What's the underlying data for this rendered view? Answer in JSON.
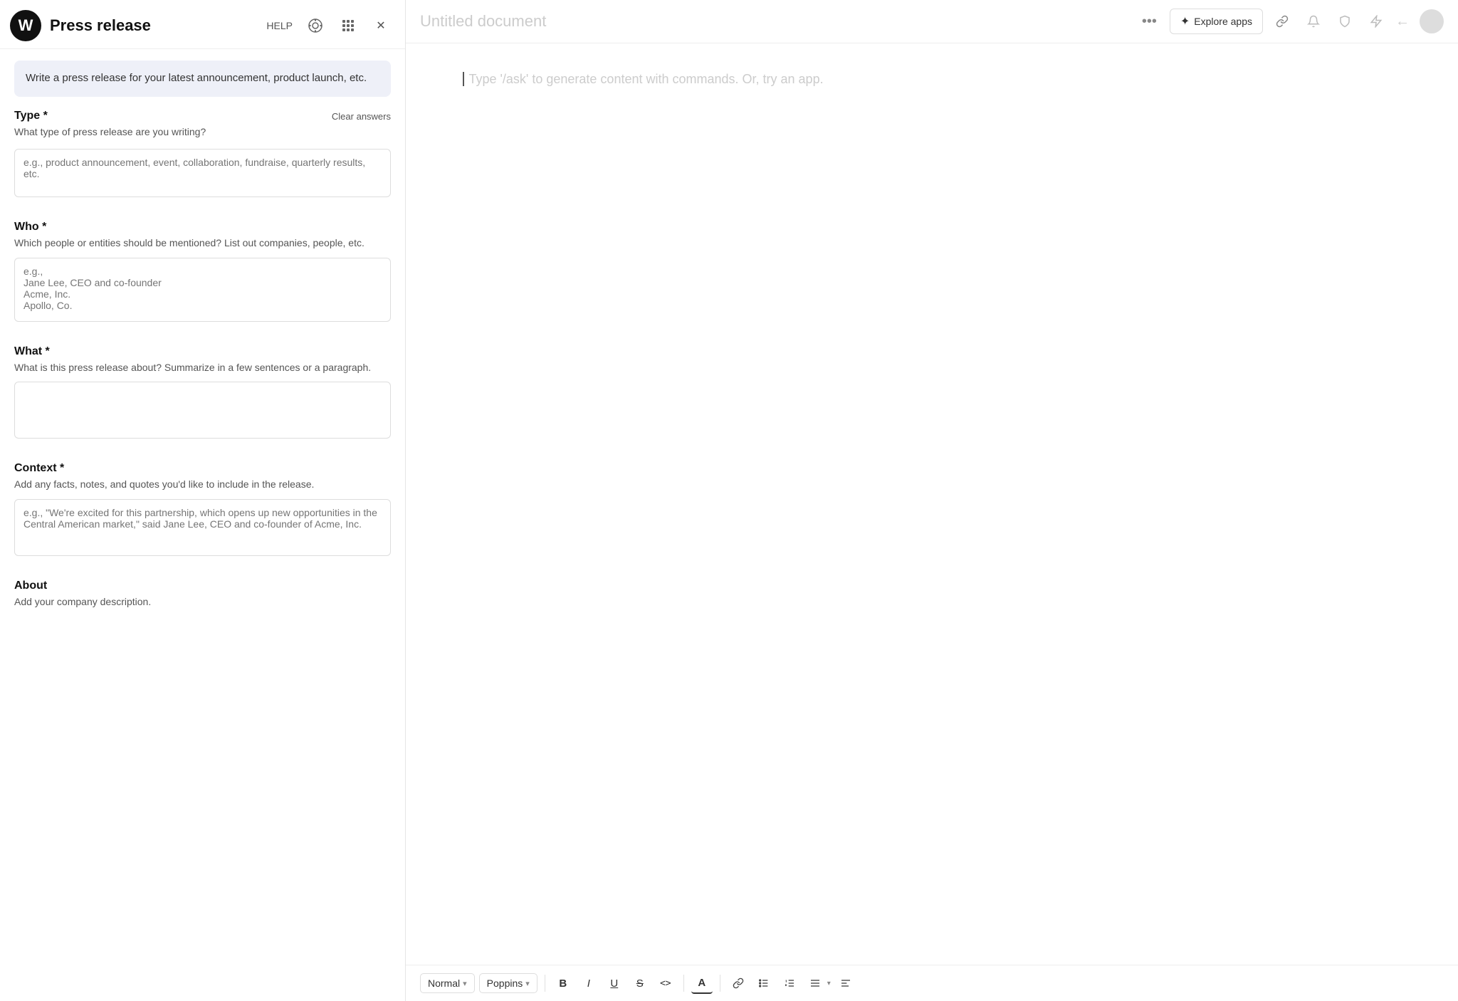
{
  "app": {
    "logo": "W",
    "panel_title": "Press release"
  },
  "header": {
    "help_label": "HELP",
    "close_icon": "✕",
    "grid_icon": "⋮⋮",
    "help_circle_icon": "⊙"
  },
  "description": {
    "text": "Write a press release for your latest announcement, product launch, etc."
  },
  "fields": [
    {
      "id": "type",
      "label": "Type *",
      "description": "What type of press release are you writing?",
      "placeholder": "e.g., product announcement, event, collaboration, fundraise, quarterly results, etc.",
      "rows": "small",
      "show_clear": true
    },
    {
      "id": "who",
      "label": "Who *",
      "description": "Which people or entities should be mentioned? List out companies, people, etc.",
      "placeholder": "e.g.,\nJane Lee, CEO and co-founder\nAcme, Inc.\nApollo, Co.",
      "rows": "multi",
      "show_clear": false
    },
    {
      "id": "what",
      "label": "What *",
      "description": "What is this press release about? Summarize in a few sentences or a paragraph.",
      "placeholder": "",
      "rows": "large",
      "show_clear": false
    },
    {
      "id": "context",
      "label": "Context *",
      "description": "Add any facts, notes, and quotes you'd like to include in the release.",
      "placeholder": "e.g., \"We're excited for this partnership, which opens up new opportunities in the Central American market,\" said Jane Lee, CEO and co-founder of Acme, Inc.",
      "rows": "context",
      "show_clear": false
    },
    {
      "id": "about",
      "label": "About",
      "description": "Add your company description.",
      "placeholder": "",
      "rows": "small",
      "show_clear": false
    }
  ],
  "clear_answers_label": "Clear answers",
  "document": {
    "title": "Untitled document",
    "placeholder": "Type '/ask' to generate content with commands. Or, try an app."
  },
  "toolbar": {
    "style_label": "Normal",
    "font_label": "Poppins",
    "chevron": "▾",
    "bold": "B",
    "italic": "I",
    "underline": "U",
    "strikethrough": "S",
    "code": "<>",
    "font_color": "A",
    "link": "🔗",
    "bullet_list": "≡",
    "ordered_list": "☰",
    "align": "≡",
    "more": "≡"
  },
  "header_actions": {
    "more_icon": "•••",
    "explore_apps_icon": "✦",
    "explore_apps_label": "Explore apps",
    "link_icon": "🔗",
    "bell_icon": "🔔",
    "shield_icon": "🛡",
    "lightning_icon": "⚡",
    "back_icon": "←",
    "avatar": ""
  }
}
